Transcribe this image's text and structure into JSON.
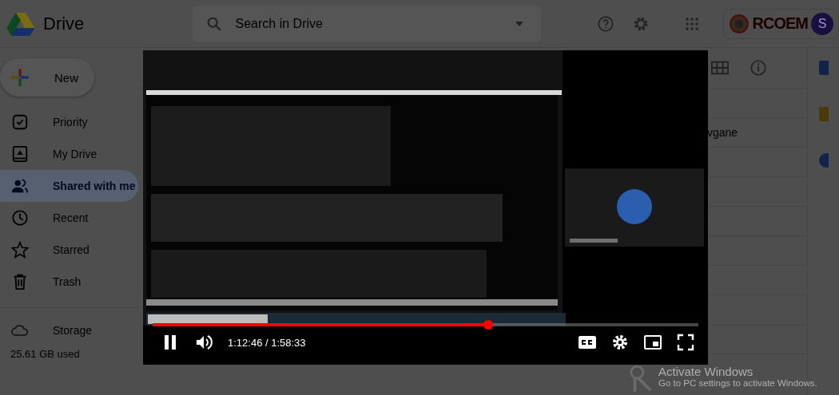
{
  "header": {
    "app_name": "Drive",
    "search": {
      "placeholder": "Search in Drive"
    },
    "org_logo": "RCOEM",
    "avatar_letter": "S"
  },
  "sidebar": {
    "new_button": "New",
    "items": [
      {
        "label": "Priority",
        "selected": false
      },
      {
        "label": "My Drive",
        "selected": false
      },
      {
        "label": "Shared with me",
        "selected": true
      },
      {
        "label": "Recent",
        "selected": false
      },
      {
        "label": "Starred",
        "selected": false
      },
      {
        "label": "Trash",
        "selected": false
      }
    ],
    "storage": {
      "label": "Storage",
      "used": "25.61 GB used"
    }
  },
  "file_list": {
    "visible_text": "vgane"
  },
  "player": {
    "playing": true,
    "level": 0.615,
    "time": "1:12:46 / 1:58:33"
  },
  "os_notice": {
    "title": "Activate Windows",
    "subtitle": "Go to PC settings to activate Windows."
  }
}
